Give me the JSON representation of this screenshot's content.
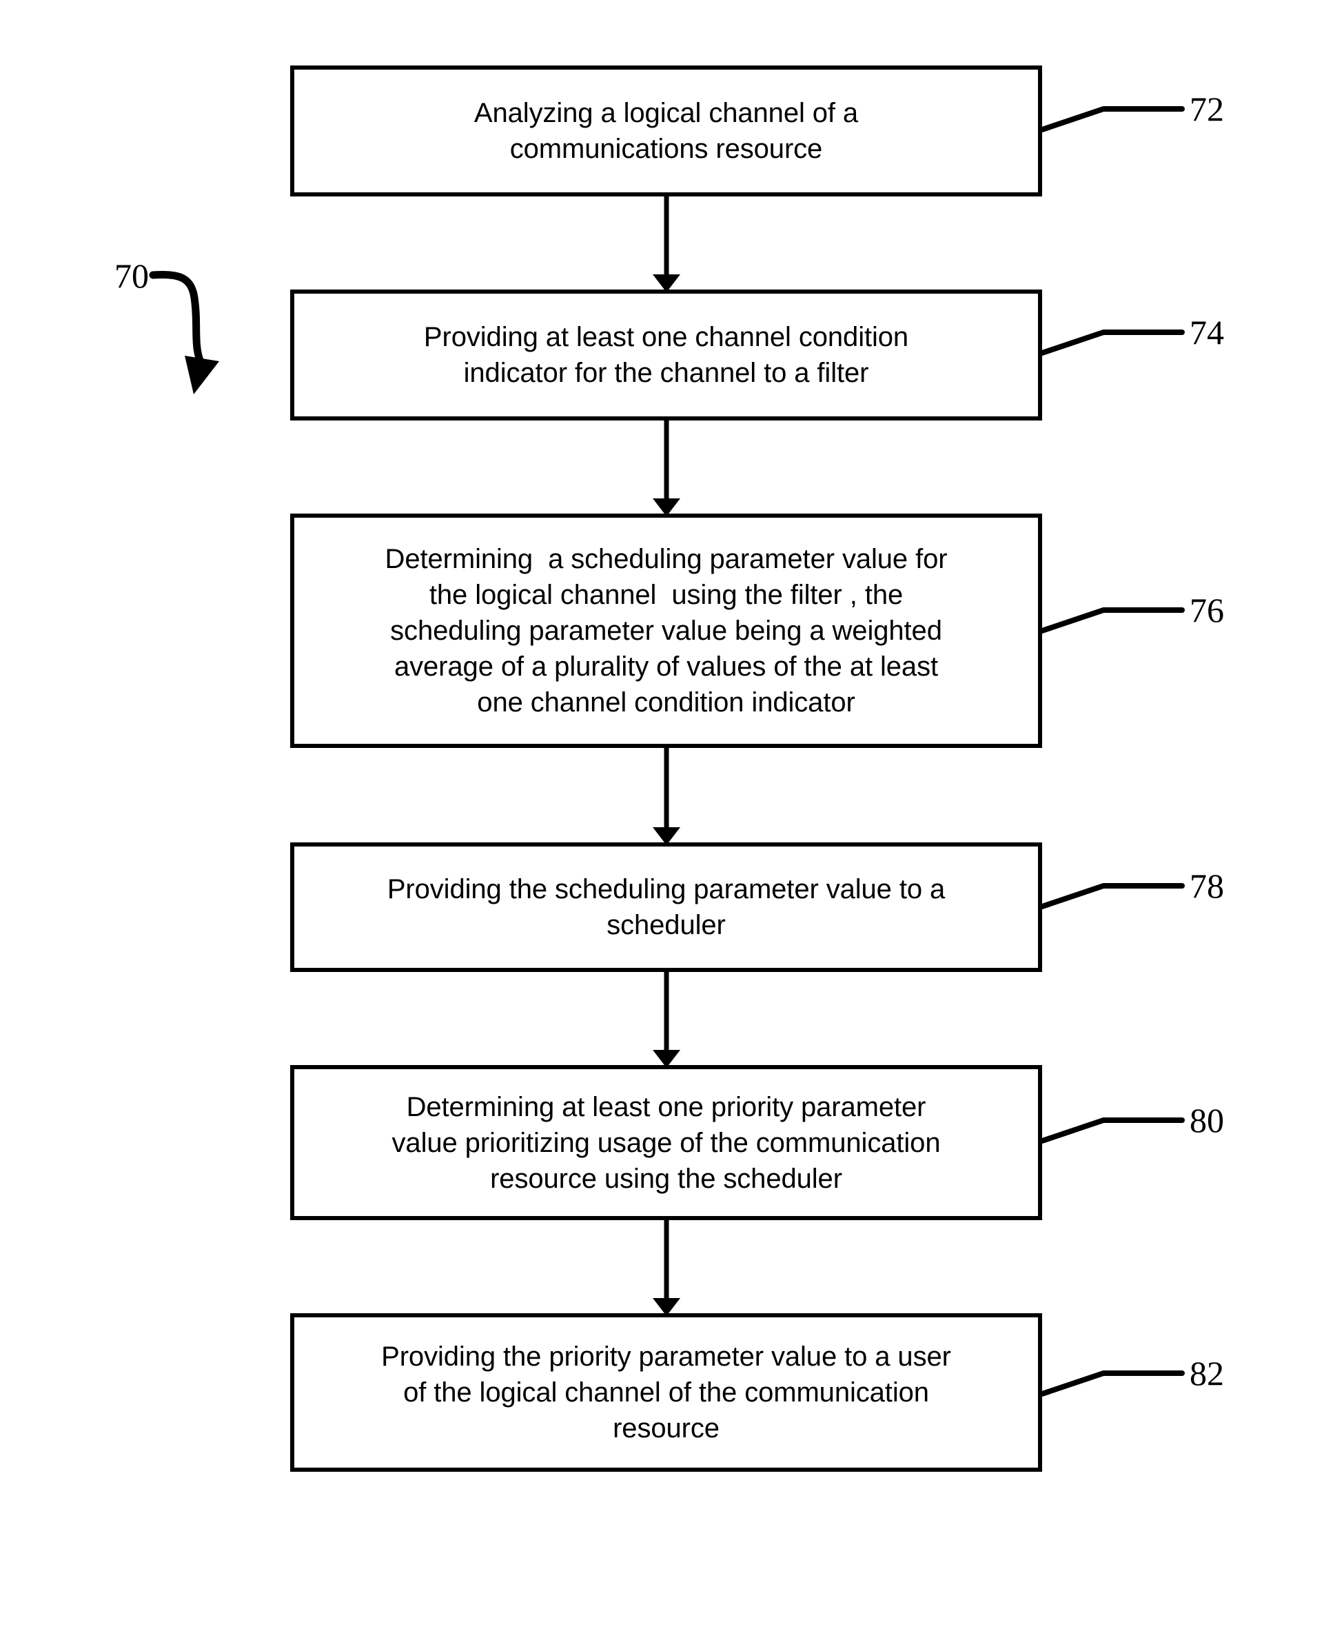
{
  "figure": {
    "diagram_label": "70",
    "background_color": "#ffffff",
    "line_color": "#000000",
    "steps": [
      {
        "ref": "72",
        "text": "Analyzing a logical channel of a\ncommunications resource"
      },
      {
        "ref": "74",
        "text": "Providing at least one channel condition\nindicator for the channel to a filter"
      },
      {
        "ref": "76",
        "text": "Determining  a scheduling parameter value for\nthe logical channel  using the filter , the\nscheduling parameter value being a weighted\naverage of a plurality of values of the at least\none channel condition indicator"
      },
      {
        "ref": "78",
        "text": "Providing the scheduling parameter value to a\nscheduler"
      },
      {
        "ref": "80",
        "text": "Determining at least one priority parameter\nvalue prioritizing usage of the communication\nresource using the scheduler"
      },
      {
        "ref": "82",
        "text": "Providing the priority parameter value to a user\nof the logical channel of the communication\nresource"
      }
    ]
  }
}
